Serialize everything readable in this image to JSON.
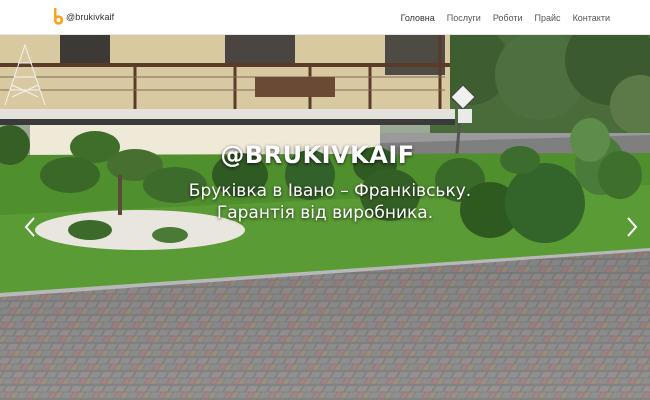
{
  "brand": {
    "name": "@brukivkaif"
  },
  "nav": {
    "items": [
      {
        "label": "Головна"
      },
      {
        "label": "Послуги"
      },
      {
        "label": "Роботи"
      },
      {
        "label": "Прайс"
      },
      {
        "label": "Контакти"
      }
    ]
  },
  "hero": {
    "title": "@BRUKIVKAIF",
    "line1": "Бруківка в Івано – Франківську.",
    "line2": "Гарантія від виробника.",
    "prev_icon": "chevron-left-icon",
    "next_icon": "chevron-right-icon"
  },
  "colors": {
    "brand_accent": "#f5a623",
    "nav_text": "#555555",
    "grass": "#4f8f2e",
    "paving": "#8d8d8d"
  }
}
